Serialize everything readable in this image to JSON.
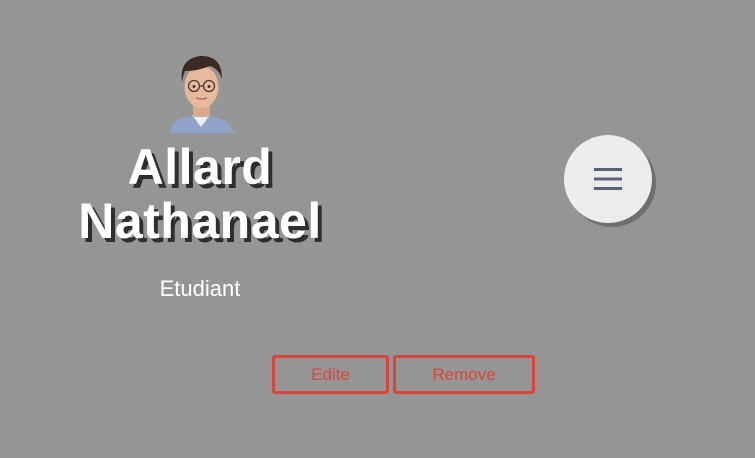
{
  "profile": {
    "avatar_alt": "profile-photo",
    "name_line1": "Allard",
    "name_line2": "Nathanael",
    "role": "Etudiant"
  },
  "actions": {
    "edit_label": "Edite",
    "remove_label": "Remove"
  },
  "menu": {
    "icon": "hamburger-menu-icon"
  },
  "colors": {
    "background": "#959595",
    "accent": "#d9463b",
    "menu_button": "#ececef",
    "menu_icon": "#5a6180"
  }
}
